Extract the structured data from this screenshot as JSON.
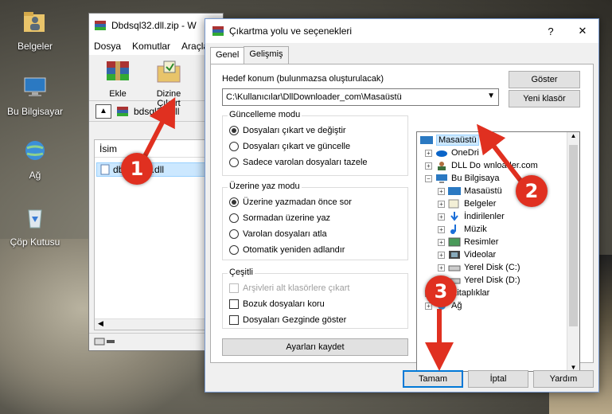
{
  "desktop": {
    "icons": [
      {
        "label": "Belgeler"
      },
      {
        "label": "Bu Bilgisayar"
      },
      {
        "label": "Ağ"
      },
      {
        "label": "Çöp Kutusu"
      }
    ]
  },
  "rar_window": {
    "title": "Dbdsql32.dll.zip - W",
    "menu": [
      "Dosya",
      "Komutlar",
      "Araçla"
    ],
    "tools": [
      "Ekle",
      "Dizine Çıkart"
    ],
    "path": "bdsql32.dll",
    "column_header": "İsim",
    "file": "dbdsql32.dll"
  },
  "dialog": {
    "title": "Çıkartma yolu ve seçenekleri",
    "help": "?",
    "close": "✕",
    "tabs": [
      "Genel",
      "Gelişmiş"
    ],
    "dest_label": "Hedef konum (bulunmazsa oluşturulacak)",
    "dest_value": "C:\\Kullanıcılar\\DllDownloader_com\\Masaüstü",
    "show_button": "Göster",
    "new_folder_button": "Yeni klasör",
    "update_group": {
      "title": "Güncelleme modu",
      "options": [
        "Dosyaları çıkart ve değiştir",
        "Dosyaları çıkart ve güncelle",
        "Sadece varolan dosyaları tazele"
      ]
    },
    "overwrite_group": {
      "title": "Üzerine yaz modu",
      "options": [
        "Üzerine yazmadan önce sor",
        "Sormadan üzerine yaz",
        "Varolan dosyaları atla",
        "Otomatik yeniden adlandır"
      ]
    },
    "misc_group": {
      "title": "Çeşitli",
      "options": [
        "Arşivleri alt klasörlere çıkart",
        "Bozuk dosyaları koru",
        "Dosyaları Gezginde göster"
      ]
    },
    "save_settings": "Ayarları kaydet",
    "tree": [
      "Masaüstü",
      "OneDri",
      "DLL Do",
      "Bu Bilgisaya",
      "Masaüstü",
      "Belgeler",
      "İndirilenler",
      "Müzik",
      "Resimler",
      "Videolar",
      "Yerel Disk (C:)",
      "Yerel Disk (D:)",
      "Kitaplıklar",
      "Ağ"
    ],
    "tree_extra": [
      "wnloader.com"
    ],
    "ok": "Tamam",
    "cancel": "İptal",
    "help_button": "Yardım"
  },
  "callouts": [
    "1",
    "2",
    "3"
  ]
}
